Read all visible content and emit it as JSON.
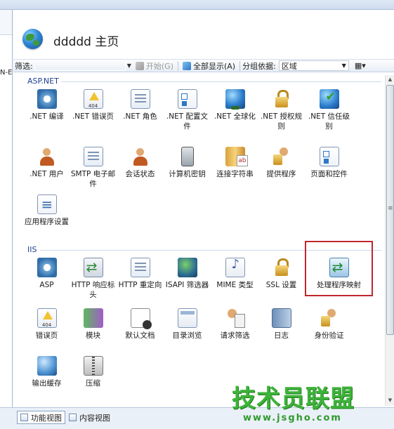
{
  "header": {
    "title": "ddddd 主页"
  },
  "left_pane": {
    "text": "N-E"
  },
  "filter_bar": {
    "filter_label": "筛选:",
    "start_label": "开始(G)",
    "show_all_label": "全部显示(A)",
    "group_by_label": "分组依据:",
    "group_by_value": "区域"
  },
  "sections": {
    "aspnet": {
      "title": "ASP.NET"
    },
    "iis": {
      "title": "IIS"
    }
  },
  "aspnet_features": [
    {
      "label": ".NET 编译",
      "icon": "compile-icon"
    },
    {
      "label": ".NET 错误页",
      "icon": "error-page-icon"
    },
    {
      "label": ".NET 角色",
      "icon": "roles-icon"
    },
    {
      "label": ".NET 配置文件",
      "icon": "profile-icon"
    },
    {
      "label": ".NET 全球化",
      "icon": "globe-icon"
    },
    {
      "label": ".NET 授权规则",
      "icon": "lock-icon"
    },
    {
      "label": ".NET 信任级别",
      "icon": "trust-icon"
    },
    {
      "label": ".NET 用户",
      "icon": "user-icon"
    },
    {
      "label": "SMTP 电子邮件",
      "icon": "mail-icon"
    },
    {
      "label": "会话状态",
      "icon": "session-icon"
    },
    {
      "label": "计算机密钥",
      "icon": "machine-key-icon"
    },
    {
      "label": "连接字符串",
      "icon": "connection-string-icon"
    },
    {
      "label": "提供程序",
      "icon": "providers-icon"
    },
    {
      "label": "页面和控件",
      "icon": "pages-controls-icon"
    },
    {
      "label": "应用程序设置",
      "icon": "app-settings-icon"
    }
  ],
  "iis_features": [
    {
      "label": "ASP",
      "icon": "asp-icon"
    },
    {
      "label": "HTTP 响应标头",
      "icon": "response-headers-icon"
    },
    {
      "label": "HTTP 重定向",
      "icon": "redirect-icon"
    },
    {
      "label": "ISAPI 筛选器",
      "icon": "isapi-icon"
    },
    {
      "label": "MIME 类型",
      "icon": "mime-icon"
    },
    {
      "label": "SSL 设置",
      "icon": "ssl-lock-icon"
    },
    {
      "label": "处理程序映射",
      "icon": "handler-mapping-icon",
      "highlighted": true
    },
    {
      "label": "错误页",
      "icon": "error-page-icon"
    },
    {
      "label": "模块",
      "icon": "modules-icon"
    },
    {
      "label": "默认文档",
      "icon": "default-document-icon"
    },
    {
      "label": "目录浏览",
      "icon": "directory-browsing-icon"
    },
    {
      "label": "请求筛选",
      "icon": "request-filtering-icon"
    },
    {
      "label": "日志",
      "icon": "logging-icon"
    },
    {
      "label": "身份验证",
      "icon": "authentication-icon"
    },
    {
      "label": "输出缓存",
      "icon": "output-cache-icon"
    },
    {
      "label": "压缩",
      "icon": "compression-icon"
    }
  ],
  "bottom_bar": {
    "features_view": "功能视图",
    "content_view": "内容视图"
  },
  "watermark": {
    "text": "技术员联盟",
    "url": "www.jsgho.com"
  },
  "colors": {
    "highlight_border": "#c0272d",
    "section_header": "#1f3f8f",
    "watermark": "#3db33a"
  }
}
